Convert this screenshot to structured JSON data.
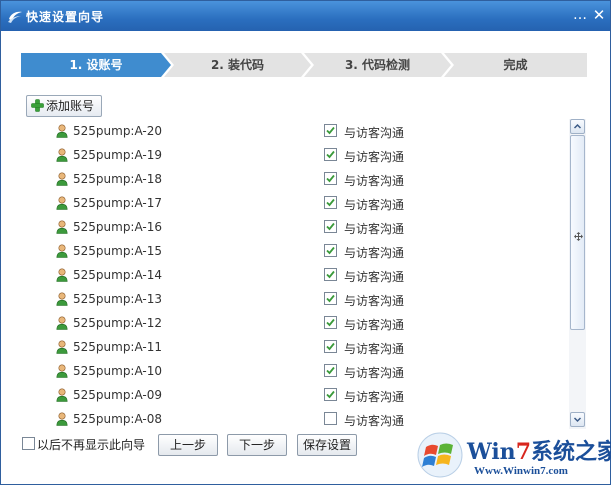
{
  "window": {
    "title": "快速设置向导",
    "minimize_glyph": "…",
    "close_glyph": "✕"
  },
  "steps": [
    {
      "label": "1. 设账号",
      "active": true
    },
    {
      "label": "2. 装代码",
      "active": false
    },
    {
      "label": "3. 代码检测",
      "active": false
    },
    {
      "label": "完成",
      "active": false
    }
  ],
  "toolbar": {
    "add_label": "添加账号",
    "add_icon": "plus-icon"
  },
  "accounts": [
    {
      "name": "525pump:A-20",
      "chat_label": "与访客沟通",
      "checked": true
    },
    {
      "name": "525pump:A-19",
      "chat_label": "与访客沟通",
      "checked": true
    },
    {
      "name": "525pump:A-18",
      "chat_label": "与访客沟通",
      "checked": true
    },
    {
      "name": "525pump:A-17",
      "chat_label": "与访客沟通",
      "checked": true
    },
    {
      "name": "525pump:A-16",
      "chat_label": "与访客沟通",
      "checked": true
    },
    {
      "name": "525pump:A-15",
      "chat_label": "与访客沟通",
      "checked": true
    },
    {
      "name": "525pump:A-14",
      "chat_label": "与访客沟通",
      "checked": true
    },
    {
      "name": "525pump:A-13",
      "chat_label": "与访客沟通",
      "checked": true
    },
    {
      "name": "525pump:A-12",
      "chat_label": "与访客沟通",
      "checked": true
    },
    {
      "name": "525pump:A-11",
      "chat_label": "与访客沟通",
      "checked": true
    },
    {
      "name": "525pump:A-10",
      "chat_label": "与访客沟通",
      "checked": true
    },
    {
      "name": "525pump:A-09",
      "chat_label": "与访客沟通",
      "checked": true
    },
    {
      "name": "525pump:A-08",
      "chat_label": "与访客沟通",
      "checked": false
    }
  ],
  "footer": {
    "dont_show_label": "以后不再显示此向导",
    "dont_show_checked": false,
    "prev_label": "上一步",
    "next_label": "下一步",
    "save_label": "保存设置"
  },
  "watermark": {
    "brand_prefix": "Win",
    "brand_seven": "7",
    "brand_suffix": "系统之家",
    "url": "Www.Winwin7.com"
  },
  "colors": {
    "titlebar": "#2b6fbf",
    "active_step": "#3f8ccf",
    "check_green": "#3a9a3a"
  }
}
